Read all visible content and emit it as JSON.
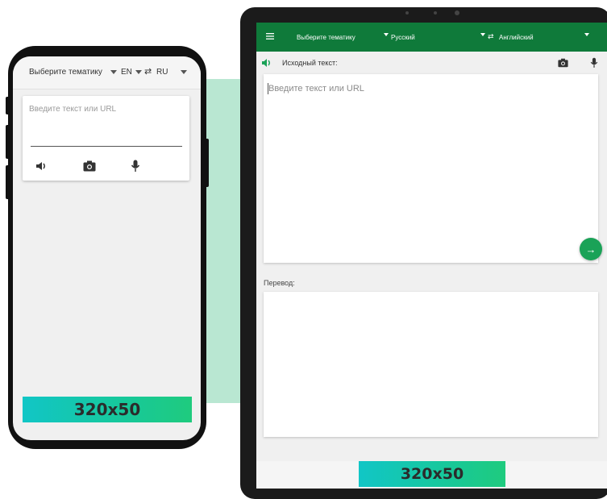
{
  "phone": {
    "topic_label": "Выберите тематику",
    "source_lang": "EN",
    "swap_symbol": "⇄",
    "target_lang": "RU",
    "input_placeholder": "Введите текст или URL",
    "banner_text": "320x50"
  },
  "tablet": {
    "topic_label": "Выберите тематику",
    "source_lang": "Русский",
    "swap_symbol": "⇄",
    "target_lang": "Английский",
    "source_text_label": "Исходный текст:",
    "input_placeholder": "Введите текст или URL",
    "translate_arrow": "→",
    "translation_label": "Перевод:",
    "banner_text": "320x50"
  },
  "colors": {
    "toolbar_green": "#0f7a3a",
    "fab_green": "#1aa257",
    "mint_background": "#b9e7d2",
    "banner_start": "#11c6c6",
    "banner_end": "#1fcb7e"
  }
}
